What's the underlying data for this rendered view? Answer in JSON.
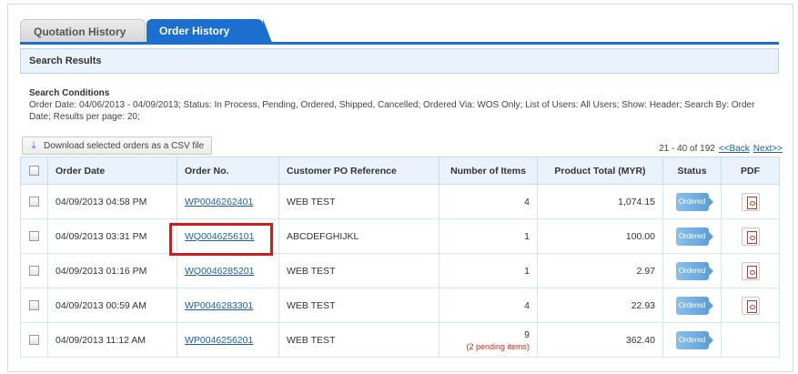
{
  "tabs": [
    {
      "label": "Quotation History",
      "active": false
    },
    {
      "label": "Order History",
      "active": true
    }
  ],
  "results_header": "Search Results",
  "conditions": {
    "title": "Search Conditions",
    "text": "Order Date: 04/06/2013 - 04/09/2013;   Status: In Process, Pending, Ordered, Shipped, Cancelled;   Ordered Via: WOS Only;   List of Users: All Users;   Show: Header;   Search By: Order Date;   Results per page: 20;"
  },
  "csv_button": "Download selected orders as a CSV file",
  "pager": {
    "range": "21 - 40 of 192",
    "back": "<<Back",
    "next": "Next>>"
  },
  "columns": [
    "Order Date",
    "Order No.",
    "Customer PO Reference",
    "Number of Items",
    "Product Total (MYR)",
    "Status",
    "PDF"
  ],
  "rows": [
    {
      "date": "04/09/2013 04:58 PM",
      "order_no": "WP0046262401",
      "po": "WEB TEST",
      "items": "4",
      "pending": "",
      "total": "1,074.15",
      "status": "Ordered",
      "pdf": true
    },
    {
      "date": "04/09/2013 03:31 PM",
      "order_no": "WQ0046256101",
      "po": "ABCDEFGHIJKL",
      "items": "1",
      "pending": "",
      "total": "100.00",
      "status": "Ordered",
      "pdf": true
    },
    {
      "date": "04/09/2013 01:16 PM",
      "order_no": "WQ0046285201",
      "po": "WEB TEST",
      "items": "1",
      "pending": "",
      "total": "2.97",
      "status": "Ordered",
      "pdf": true
    },
    {
      "date": "04/09/2013 00:59 AM",
      "order_no": "WP0046283301",
      "po": "WEB TEST",
      "items": "4",
      "pending": "",
      "total": "22.93",
      "status": "Ordered",
      "pdf": true
    },
    {
      "date": "04/09/2013 11:12 AM",
      "order_no": "WP0046256201",
      "po": "WEB TEST",
      "items": "9",
      "pending": "(2 pending items)",
      "total": "362.40",
      "status": "Ordered",
      "pdf": false
    }
  ],
  "colors": {
    "accent": "#1a6fcf",
    "highlight": "#d01c1c",
    "pending": "#d12a1a"
  }
}
